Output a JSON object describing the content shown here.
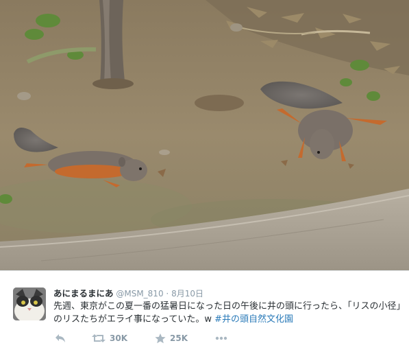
{
  "tweet": {
    "display_name": "あにまるまにあ",
    "handle": "@MSM_810",
    "separator": "·",
    "date": "8月10日",
    "text": "先週、東京がこの夏一番の猛暑日になった日の午後に井の頭に行ったら、「リスの小径」のリスたちがエライ事になっていた。w",
    "hashtag": "#井の頭自然文化園",
    "retweets": "30K",
    "likes": "25K"
  },
  "icons": {
    "reply": "reply-icon",
    "retweet": "retweet-icon",
    "like": "star-icon",
    "more": "more-dots-icon"
  },
  "colors": {
    "link": "#2b7bb9",
    "muted": "#8899a6",
    "text": "#292f33"
  }
}
